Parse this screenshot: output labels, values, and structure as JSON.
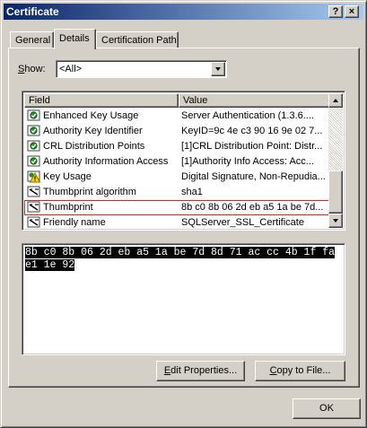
{
  "window": {
    "title": "Certificate",
    "help_button": "?",
    "close_button": "×"
  },
  "tabs": [
    {
      "label": "General",
      "active": false
    },
    {
      "label": "Details",
      "active": true
    },
    {
      "label": "Certification Path",
      "active": false
    }
  ],
  "show": {
    "label_prefix": "",
    "label_underlined": "S",
    "label_suffix": "how:",
    "selected": "<All>"
  },
  "list": {
    "columns": [
      "Field",
      "Value"
    ],
    "rows": [
      {
        "field": "Enhanced Key Usage",
        "value": "Server Authentication (1.3.6....",
        "icon": "certificate-extension-icon"
      },
      {
        "field": "Authority Key Identifier",
        "value": "KeyID=9c 4e c3 90 16 9e 02 7...",
        "icon": "certificate-extension-icon"
      },
      {
        "field": "CRL Distribution Points",
        "value": "[1]CRL Distribution Point: Distr...",
        "icon": "certificate-extension-icon"
      },
      {
        "field": "Authority Information Access",
        "value": "[1]Authority Info Access: Acc...",
        "icon": "certificate-extension-icon"
      },
      {
        "field": "Key Usage",
        "value": "Digital Signature, Non-Repudia...",
        "icon": "critical-extension-warning-icon"
      },
      {
        "field": "Thumbprint algorithm",
        "value": "sha1",
        "icon": "property-icon"
      },
      {
        "field": "Thumbprint",
        "value": "8b c0 8b 06 2d eb a5 1a be 7d...",
        "icon": "property-icon",
        "selected": true
      },
      {
        "field": "Friendly name",
        "value": "SQLServer_SSL_Certificate",
        "icon": "property-icon"
      }
    ]
  },
  "detail_value": "8b c0 8b 06 2d eb a5 1a be 7d 8d 71 ac cc 4b 1f fa e1 1e 92",
  "buttons": {
    "edit_properties": {
      "pre": "",
      "u": "E",
      "post": "dit Properties..."
    },
    "copy_to_file": {
      "pre": "",
      "u": "C",
      "post": "opy to File..."
    },
    "ok": "OK"
  },
  "colors": {
    "title_gradient_start": "#0a246a",
    "title_gradient_end": "#a6caf0",
    "face": "#d4d0c8",
    "selection_outline": "#e0201e"
  }
}
